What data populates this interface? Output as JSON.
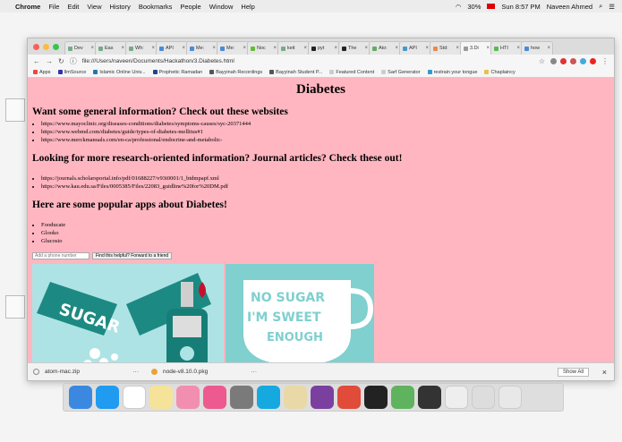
{
  "menubar": {
    "app": "Chrome",
    "items": [
      "File",
      "Edit",
      "View",
      "History",
      "Bookmarks",
      "People",
      "Window",
      "Help"
    ],
    "battery": "30%",
    "clock": "Sun 8:57 PM",
    "user": "Naveen Ahmed"
  },
  "tabs": [
    "Dev",
    "Eas",
    "Wh:",
    "API",
    "Me:",
    "Me:",
    "Noc",
    "keit",
    "pyt",
    "The",
    "Ato:",
    "API",
    "Std:",
    "3.Di",
    "HTI",
    "how"
  ],
  "address": "file:///Users/naveen/Documents/Hackathon/3.Diabetes.html",
  "bookmarks": [
    "Apps",
    "IlmSource",
    "Islamic Online Univ...",
    "Prophetic Ramadan",
    "Bayyinah Recordings",
    "Bayyinah Student P...",
    "Featured Content",
    "Sarf Generator",
    "restrain your tongue",
    "Chaplaincy"
  ],
  "page": {
    "title": "Diabetes",
    "heading1": "Want some general information? Check out these websites",
    "general_links": [
      "https://www.mayoclinic.org/diseases-conditions/diabetes/symptoms-causes/syc-20371444",
      "https://www.webmd.com/diabetes/guide/types-of-diabetes-mellitus#1",
      "https://www.merckmanuals.com/en-ca/professional/endocrine-and-metabolic-"
    ],
    "heading2": "Looking for more research-oriented information? Journal articles? Check these out!",
    "research_links": [
      "https://journals.scholarsportal.info/pdf/01688227/v93i0001/1_btdmpapf.xml",
      "https://www.kau.edu.sa/Files/0005385/Files/22083_guidline%20for%20DM.pdf"
    ],
    "heading3": "Here are some popular apps about Diabetes!",
    "apps": [
      "Fooducate",
      "Glooko",
      "Glucosio"
    ],
    "phone_placeholder": "Add a phone number",
    "forward_button": "Find this helpful? Forward to a friend",
    "image1_text": "SUGAR",
    "image2_line1": "NO SUGAR",
    "image2_line2": "I'M SWEET",
    "image2_line3": "ENOUGH"
  },
  "downloads": {
    "items": [
      "atom-mac.zip",
      "node-v8.10.0.pkg"
    ],
    "show_all": "Show All"
  },
  "colors": {
    "page_bg": "#ffb6c1",
    "image1_bg": "#aee3e5",
    "image2_bg": "#7fd0cf"
  }
}
